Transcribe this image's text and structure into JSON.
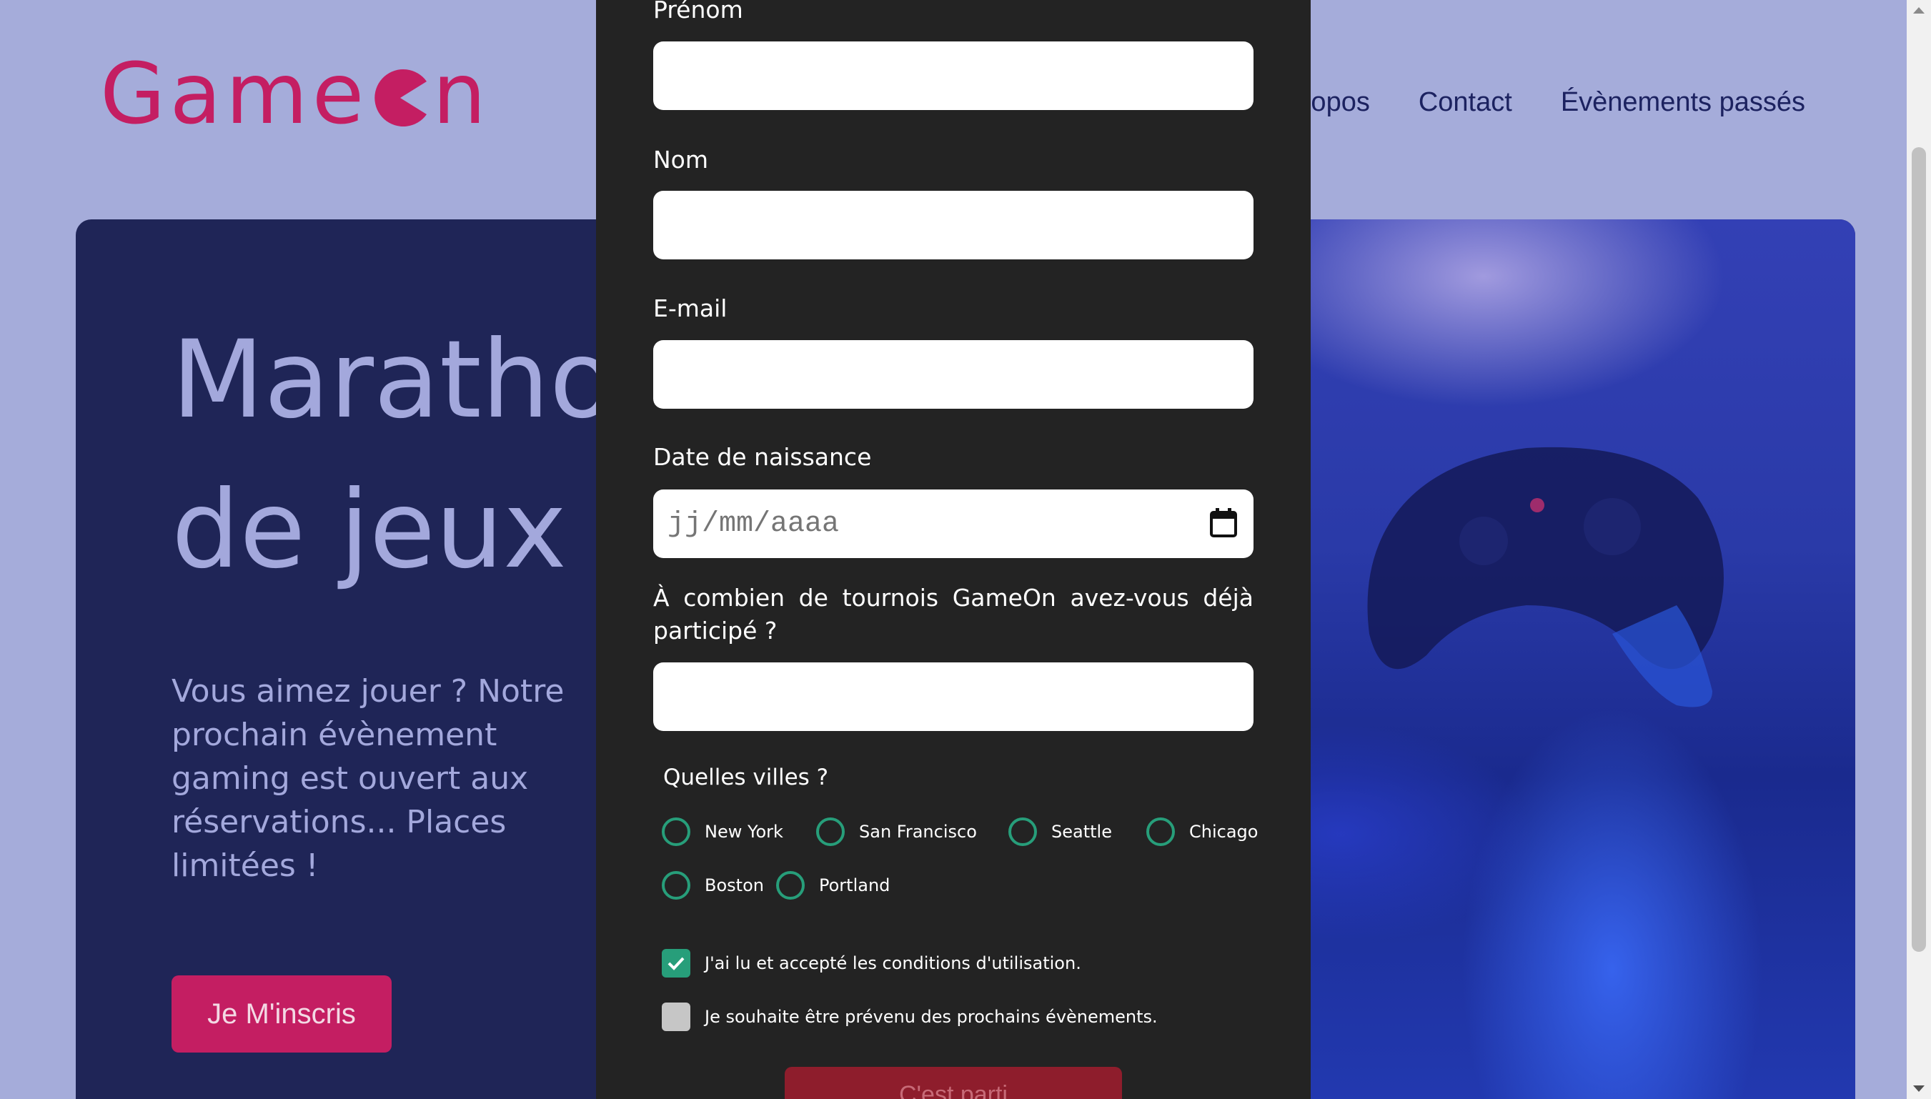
{
  "brand": {
    "logo_text_before": "Game",
    "logo_text_after": "n",
    "color": "#c41e62"
  },
  "nav": {
    "items": [
      "propos",
      "Contact",
      "Évènements passés"
    ]
  },
  "hero": {
    "title_line1": "Maratho",
    "title_line2": "de jeux v",
    "text": "Vous aimez jouer ? Notre prochain évènement gaming est ouvert aux réservations... Places limitées !",
    "cta": "Je M'inscris"
  },
  "form": {
    "prenom_label": "Prénom",
    "nom_label": "Nom",
    "email_label": "E-mail",
    "birthdate_label": "Date de naissance",
    "birthdate_placeholder": "jj/mm/aaaa",
    "quantity_question": "À combien de tournois GameOn avez-vous déjà participé ?",
    "cities_title": "Quelles villes ?",
    "cities": [
      "New York",
      "San Francisco",
      "Seattle",
      "Chicago",
      "Boston",
      "Portland"
    ],
    "terms_label": "J'ai lu et accepté les conditions d'utilisation.",
    "terms_checked": true,
    "newsletter_label": "Je souhaite être prévenu des prochains évènements.",
    "newsletter_checked": false,
    "submit_label": "C'est parti",
    "accent_color": "#279e7a"
  }
}
